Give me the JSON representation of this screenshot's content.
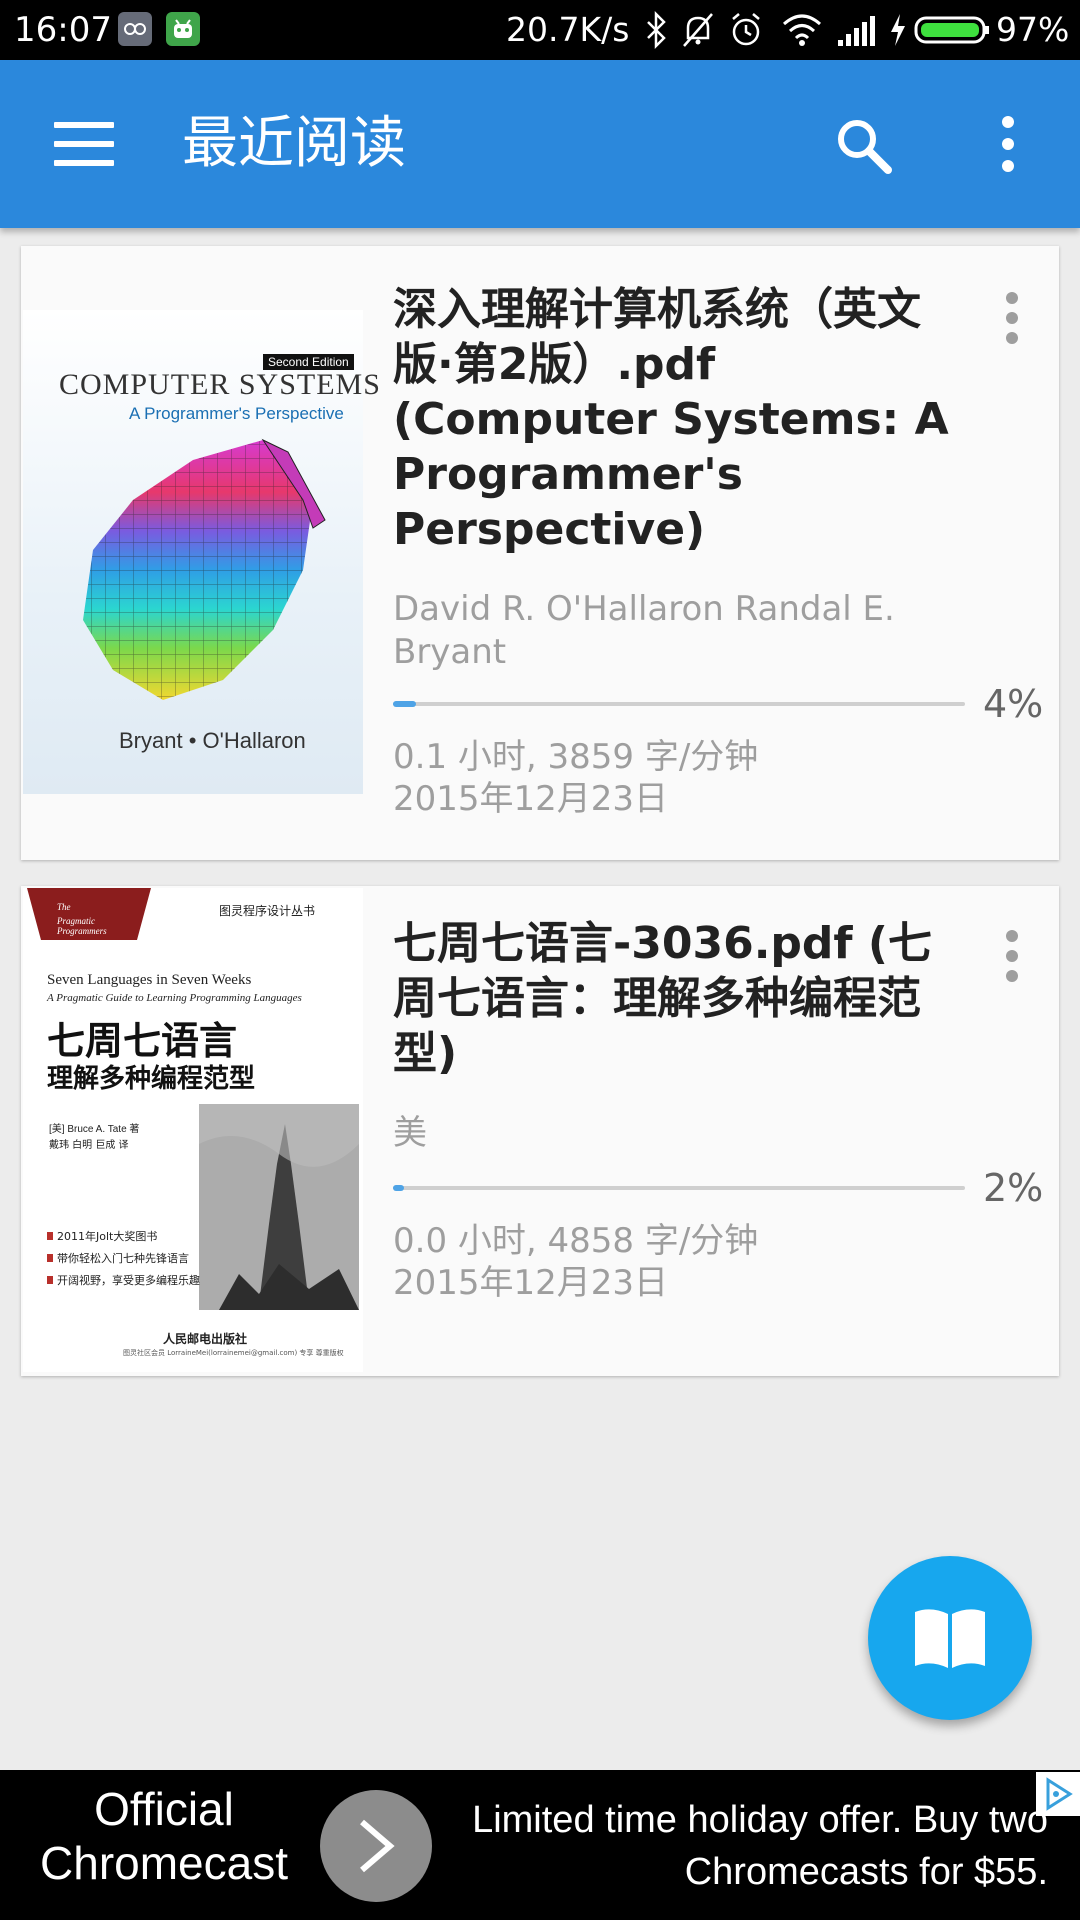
{
  "status_bar": {
    "time": "16:07",
    "net_speed": "20.7K/s",
    "battery_percent": "97%",
    "icons": [
      "app-icon-1",
      "android-icon",
      "bluetooth-icon",
      "notifications-off-icon",
      "alarm-icon",
      "wifi-icon",
      "signal-icon",
      "charging-icon",
      "battery-icon"
    ]
  },
  "app_bar": {
    "title": "最近阅读",
    "icons": [
      "menu-icon",
      "search-icon",
      "more-vert-icon"
    ]
  },
  "books": [
    {
      "title": "深入理解计算机系统（英文版·第2版）.pdf (Computer Systems: A Programmer's Perspective)",
      "author": "David R. O'Hallaron Randal E. Bryant",
      "progress_percent": 4,
      "progress_label": "4%",
      "reading_stats": "0.1 小时, 3859 字/分钟",
      "date": "2015年12月23日",
      "cover": {
        "edition": "Second Edition",
        "title": "COMPUTER SYSTEMS",
        "subtitle": "A Programmer's Perspective",
        "authors": "Bryant • O'Hallaron"
      }
    },
    {
      "title": "七周七语言-3036.pdf (七周七语言：理解多种编程范型)",
      "author": "美",
      "progress_percent": 2,
      "progress_label": "2%",
      "reading_stats": "0.0 小时, 4858 字/分钟",
      "date": "2015年12月23日",
      "cover": {
        "banner": "The Pragmatic Programmers",
        "series": "图灵程序设计丛书",
        "title_en": "Seven Languages in Seven Weeks",
        "subtitle_en": "A Pragmatic Guide to Learning Programming Languages",
        "title_cn": "七周七语言",
        "subtitle_cn": "理解多种编程范型",
        "author_line": "[美] Bruce A. Tate 著",
        "translator_line": "戴玮 白明 巨成 译",
        "bullets": [
          "2011年Jolt大奖图书",
          "带你轻松入门七种先锋语言",
          "开阔视野，享受更多编程乐趣"
        ],
        "publisher": "人民邮电出版社",
        "license": "图灵社区会员 LorraineMei(lorrainemei@gmail.com) 专享 尊重版权"
      }
    }
  ],
  "fab": {
    "icon": "open-book-icon"
  },
  "ad": {
    "left_text": "Official Chromecast",
    "right_text": "Limited time holiday offer. Buy two Chromecasts for $55.",
    "icons": [
      "arrow-right-icon",
      "adchoices-icon"
    ]
  }
}
